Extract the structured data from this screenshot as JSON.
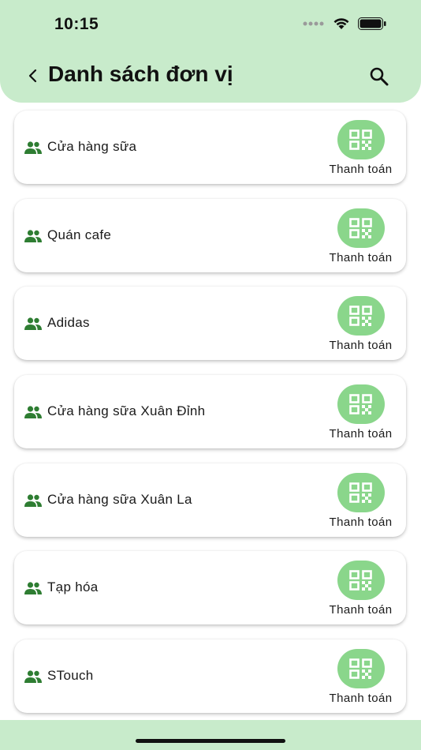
{
  "status_bar": {
    "time": "10:15"
  },
  "header": {
    "title": "Danh sách đơn vị"
  },
  "units": [
    {
      "name": "Cửa hàng sữa",
      "action": "Thanh toán"
    },
    {
      "name": "Quán cafe",
      "action": "Thanh toán"
    },
    {
      "name": "Adidas",
      "action": "Thanh toán"
    },
    {
      "name": "Cửa hàng sữa Xuân Đỉnh",
      "action": "Thanh toán"
    },
    {
      "name": "Cửa hàng sữa Xuân La",
      "action": "Thanh toán"
    },
    {
      "name": "Tạp hóa",
      "action": "Thanh toán"
    },
    {
      "name": "STouch",
      "action": "Thanh toán"
    }
  ],
  "colors": {
    "header_bg": "#c8ebcb",
    "qr_button": "#8ad68b",
    "group_icon": "#2e7d32"
  },
  "icons": {
    "back": "chevron-left-icon",
    "search": "search-icon",
    "unit": "group-icon",
    "pay": "qr-code-icon"
  }
}
